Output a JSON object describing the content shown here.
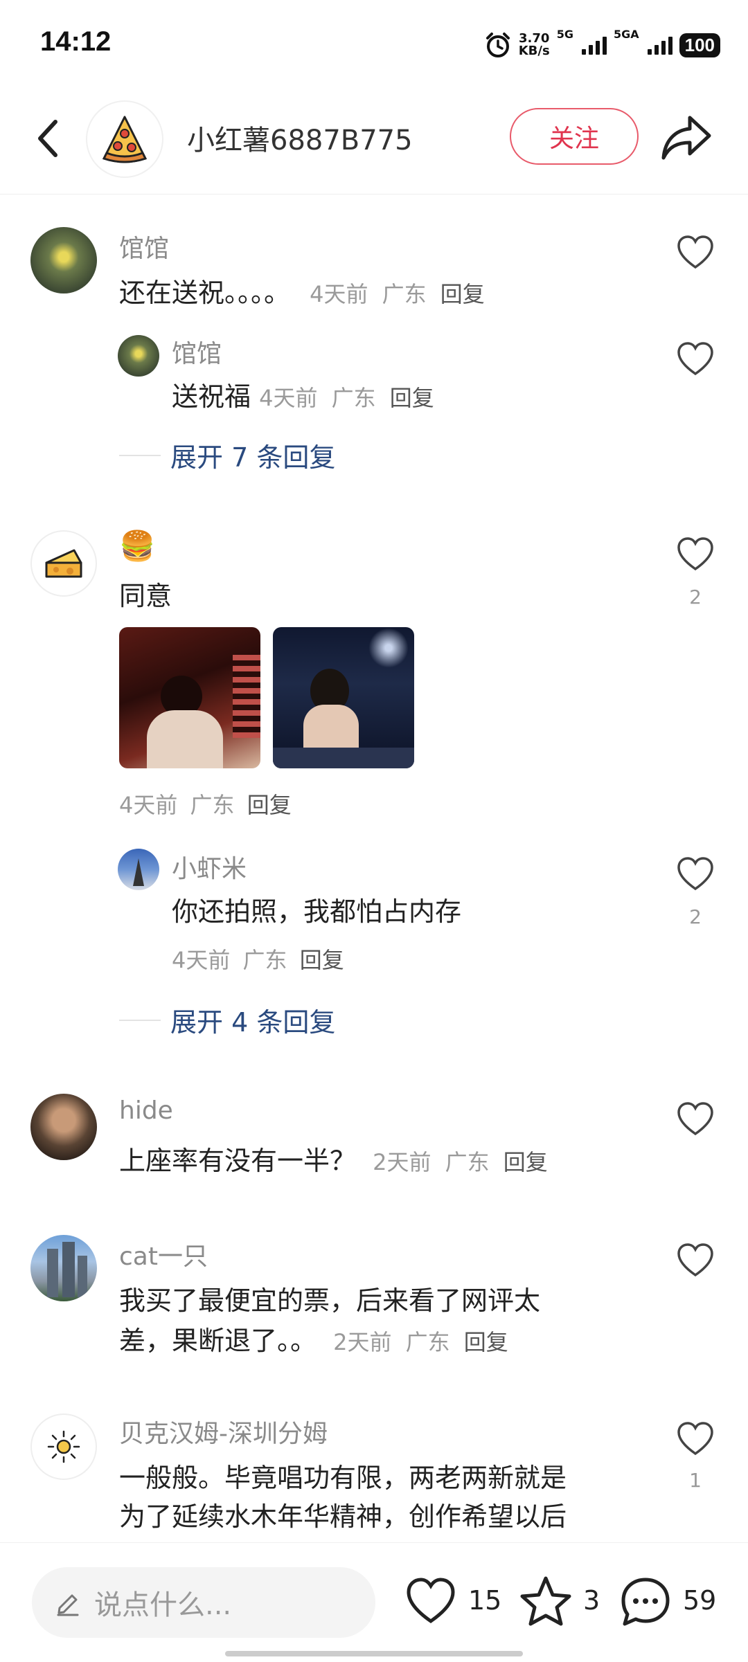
{
  "status_bar": {
    "time": "14:12",
    "net_speed_value": "3.70",
    "net_speed_unit": "KB/s",
    "sim1_label": "5G",
    "sim2_label": "5GA",
    "battery": "100"
  },
  "header": {
    "username": "小红薯6887B775",
    "follow_label": "关注"
  },
  "comments": [
    {
      "username": "馆馆",
      "text": "还在送祝。。。。",
      "time": "4天前",
      "location": "广东",
      "reply_label": "回复",
      "sub_reply": {
        "username": "馆馆",
        "text": "送祝福",
        "time": "4天前",
        "location": "广东",
        "reply_label": "回复"
      },
      "expand_label": "展开 7 条回复"
    },
    {
      "username_emoji": "🍔",
      "text": "同意",
      "time": "4天前",
      "location": "广东",
      "reply_label": "回复",
      "like_count": "2",
      "sub_reply": {
        "username": "小虾米",
        "text": "你还拍照，我都怕占内存",
        "time": "4天前",
        "location": "广东",
        "reply_label": "回复",
        "like_count": "2"
      },
      "expand_label": "展开 4 条回复"
    },
    {
      "username": "hide",
      "text": "上座率有没有一半？",
      "time": "2天前",
      "location": "广东",
      "reply_label": "回复"
    },
    {
      "username": "cat一只",
      "text_line1": "我买了最便宜的票，后来看了网评太",
      "text_line2": "差，果断退了。。",
      "time": "2天前",
      "location": "广东",
      "reply_label": "回复"
    },
    {
      "username": "贝克汉姆-深圳分姆",
      "text_line1": "一般般。毕竟唱功有限，两老两新就是",
      "text_line2": "为了延续水木年华精神，创作希望以后",
      "like_count": "1"
    }
  ],
  "bottom_bar": {
    "input_placeholder": "说点什么...",
    "like_count": "15",
    "star_count": "3",
    "comment_count": "59"
  },
  "colors": {
    "accent_red": "#e0344e",
    "link_blue": "#2a4a7f"
  }
}
